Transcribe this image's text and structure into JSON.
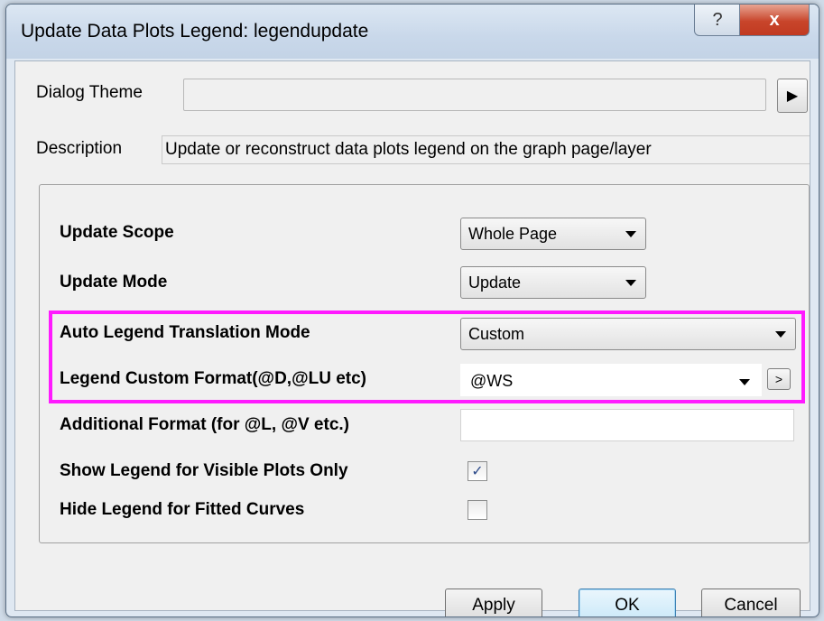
{
  "window": {
    "title": "Update Data Plots Legend: legendupdate",
    "help_glyph": "?",
    "close_glyph": "x"
  },
  "theme": {
    "label": "Dialog Theme",
    "value": "",
    "arrow_glyph": "▶"
  },
  "description": {
    "label": "Description",
    "text": "Update or reconstruct data plots legend on the graph page/layer"
  },
  "settings": {
    "update_scope": {
      "label": "Update Scope",
      "value": "Whole Page"
    },
    "update_mode": {
      "label": "Update Mode",
      "value": "Update"
    },
    "auto_translation_mode": {
      "label": "Auto Legend Translation Mode",
      "value": "Custom"
    },
    "custom_format": {
      "label": "Legend Custom Format(@D,@LU etc)",
      "value": "@WS",
      "button_glyph": ">"
    },
    "additional_format": {
      "label": "Additional Format (for @L, @V etc.)",
      "value": ""
    },
    "visible_only": {
      "label": "Show Legend for Visible Plots Only",
      "checked": true,
      "check_glyph": "✓"
    },
    "hide_fitted": {
      "label": "Hide Legend for Fitted Curves",
      "checked": false,
      "check_glyph": ""
    }
  },
  "buttons": {
    "apply": "Apply",
    "ok": "OK",
    "cancel": "Cancel"
  },
  "colors": {
    "highlight": "#ff1aff",
    "close_button": "#c8452b"
  }
}
